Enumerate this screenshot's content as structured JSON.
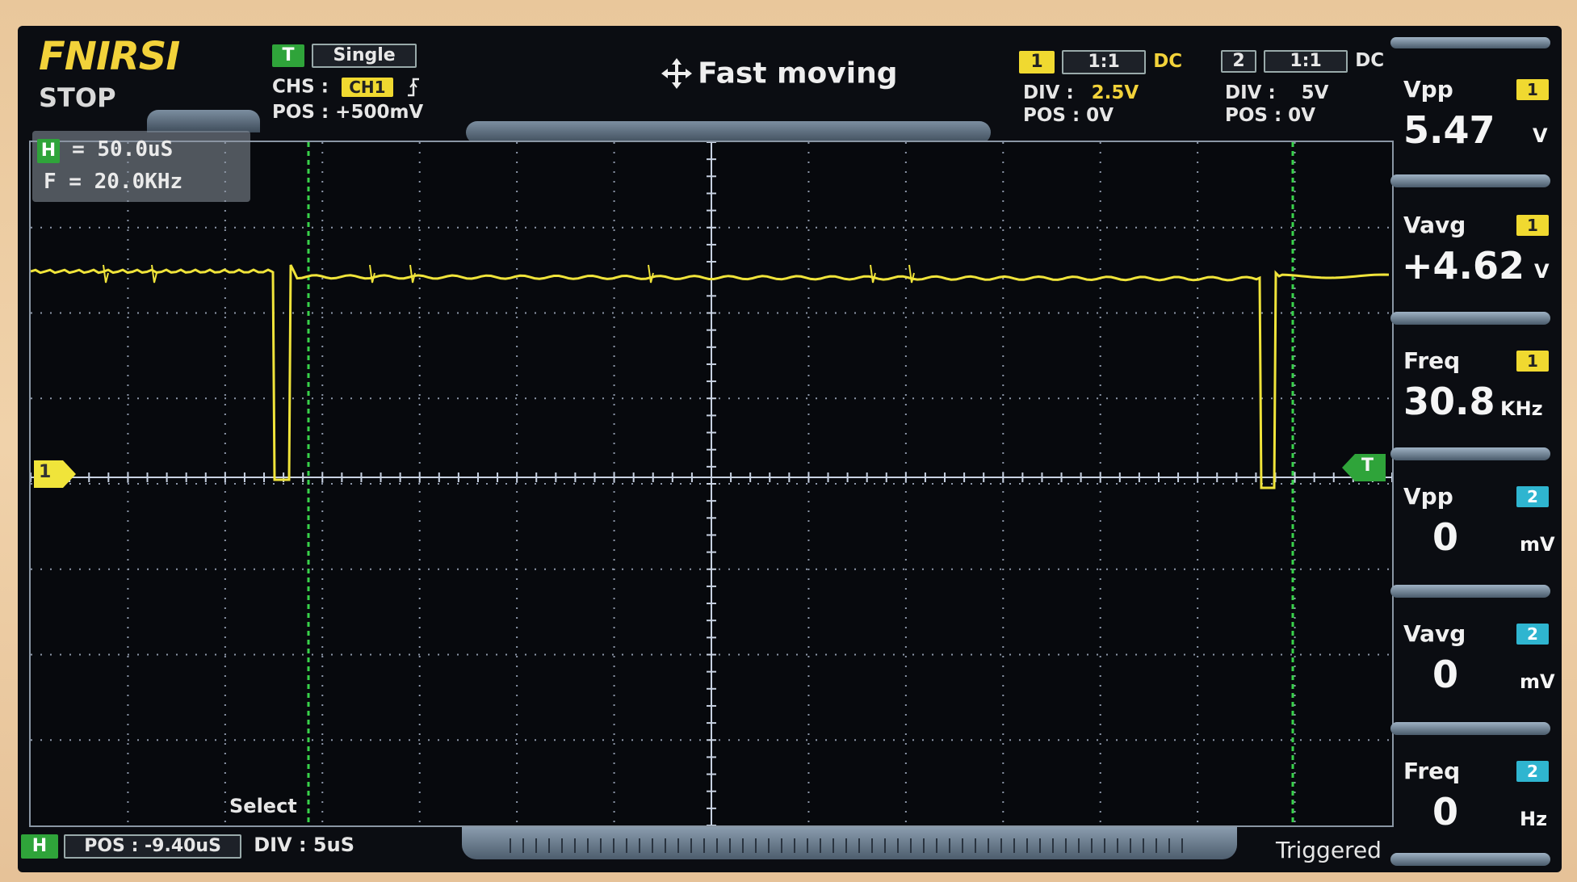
{
  "brand": "FNIRSI",
  "run_state": "STOP",
  "trigger": {
    "badge": "T",
    "mode": "Single",
    "source_label": "CHS :",
    "source": "CH1",
    "edge_icon": "rising-edge-icon",
    "pos_label": "POS : +500mV"
  },
  "status_message": "Fast moving",
  "channel1": {
    "badge": "1",
    "probe": "1:1",
    "coupling": "DC",
    "div_label": "DIV :",
    "div_value": "2.5V",
    "pos_label": "POS : 0V",
    "color": "#f0e43a"
  },
  "channel2": {
    "badge": "2",
    "probe": "1:1",
    "coupling": "DC",
    "div_label": "DIV :",
    "div_value": "5V",
    "pos_label": "POS : 0V",
    "color": "#2fb5d0"
  },
  "cursor_readout": {
    "h_badge": "H",
    "h_text": "= 50.0uS",
    "f_text": "F = 20.0KHz"
  },
  "markers": {
    "ch1_marker": "1",
    "trigger_marker": "T"
  },
  "measurements": [
    {
      "title": "Vpp",
      "channel": "1",
      "value": "5.47",
      "unit": "V"
    },
    {
      "title": "Vavg",
      "channel": "1",
      "value": "+4.62",
      "unit": "V"
    },
    {
      "title": "Freq",
      "channel": "1",
      "value": "30.8",
      "unit": "KHz"
    },
    {
      "title": "Vpp",
      "channel": "2",
      "value": "0",
      "unit": "mV"
    },
    {
      "title": "Vavg",
      "channel": "2",
      "value": "0",
      "unit": "mV"
    },
    {
      "title": "Freq",
      "channel": "2",
      "value": "0",
      "unit": "Hz"
    }
  ],
  "bottom": {
    "h_badge": "H",
    "pos_label": "POS : -9.40uS",
    "div_label": "DIV : 5uS",
    "select_label": "Select",
    "trigger_status": "Triggered"
  }
}
